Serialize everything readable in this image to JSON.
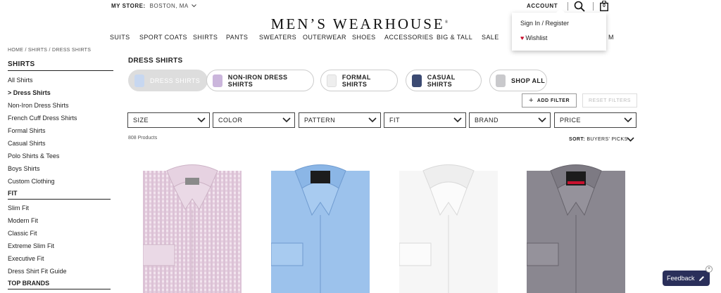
{
  "header": {
    "store_label": "MY STORE:",
    "store_city": "BOSTON, MA",
    "account_label": "ACCOUNT",
    "cart_count": "0",
    "logo_text": "MEN’S WEARHOUSE"
  },
  "nav": [
    "SUITS",
    "SPORT COATS",
    "SHIRTS",
    "PANTS",
    "SWEATERS",
    "OUTERWEAR",
    "SHOES",
    "ACCESSORIES",
    "BIG & TALL",
    "SALE",
    "M"
  ],
  "account_menu": {
    "signin": "Sign In / Register",
    "wishlist": "Wishlist"
  },
  "breadcrumb": "HOME / SHIRTS / DRESS SHIRTS",
  "sidebar": {
    "shirts_heading": "SHIRTS",
    "shirts": [
      "All Shirts",
      ">  Dress Shirts",
      "Non-Iron Dress Shirts",
      "French Cuff Dress Shirts",
      "Formal Shirts",
      "Casual Shirts",
      "Polo Shirts & Tees",
      "Boys Shirts",
      "Custom Clothing"
    ],
    "fit_heading": "FIT",
    "fit": [
      "Slim Fit",
      "Modern Fit",
      "Classic Fit",
      "Extreme Slim Fit",
      "Executive Fit",
      "Dress Shirt Fit Guide"
    ],
    "brands_heading": "TOP BRANDS"
  },
  "main": {
    "title": "DRESS SHIRTS",
    "pills": [
      "DRESS SHIRTS",
      "NON-IRON DRESS SHIRTS",
      "FORMAL SHIRTS",
      "CASUAL SHIRTS",
      "SHOP ALL"
    ],
    "add_filter": "ADD FILTER",
    "reset_filters": "RESET FILTERS",
    "filters": [
      "SIZE",
      "COLOR",
      "PATTERN",
      "FIT",
      "BRAND",
      "PRICE"
    ],
    "product_count": "808 Products",
    "sort_label": "SORT:",
    "sort_value": "BUYERS' PICKS"
  },
  "feedback_label": "Feedback",
  "colors": {
    "brand_navy": "#2a2f5a",
    "heart_red": "#c8102e",
    "shirt_pink": "#e8cbe0",
    "shirt_blue": "#9cc2ec",
    "shirt_white": "#f6f6f6",
    "shirt_gray": "#8a8790"
  }
}
